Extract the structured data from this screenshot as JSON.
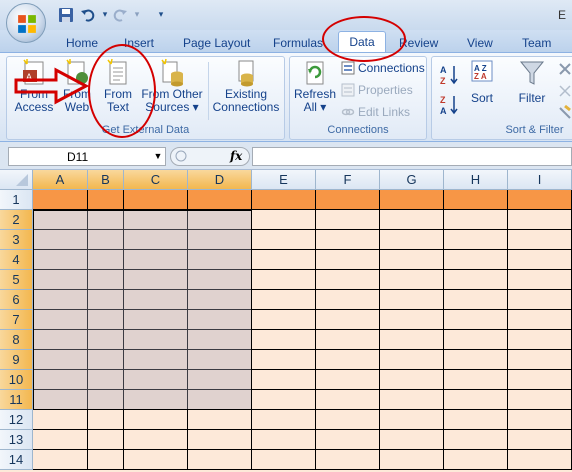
{
  "title_bar": {
    "title_fragment": "E"
  },
  "quick_access": {
    "undo_arrow": "▾",
    "redo_arrow": "▾",
    "customize_arrow": "▾"
  },
  "tabs": [
    "Home",
    "Insert",
    "Page Layout",
    "Formulas",
    "Data",
    "Review",
    "View",
    "Team"
  ],
  "active_tab": "Data",
  "ribbon": {
    "get_external_data": {
      "label": "Get External Data",
      "buttons": [
        {
          "line1": "From",
          "line2": "Access",
          "icon": "access-db-icon"
        },
        {
          "line1": "From",
          "line2": "Web",
          "icon": "web-globe-icon"
        },
        {
          "line1": "From",
          "line2": "Text",
          "icon": "text-file-icon"
        },
        {
          "line1": "From Other",
          "line2": "Sources ▾",
          "icon": "other-sources-icon"
        },
        {
          "line1": "Existing",
          "line2": "Connections",
          "icon": "existing-connections-icon"
        }
      ]
    },
    "connections": {
      "label": "Connections",
      "refresh_line1": "Refresh",
      "refresh_line2": "All ▾",
      "items": [
        {
          "label": "Connections",
          "enabled": true
        },
        {
          "label": "Properties",
          "enabled": false
        },
        {
          "label": "Edit Links",
          "enabled": false
        }
      ]
    },
    "sort_filter": {
      "label": "Sort & Filter",
      "sort_label": "Sort",
      "filter_label": "Filter",
      "sort_az_icon": "sort-ascending-icon",
      "sort_za_icon": "sort-descending-icon"
    }
  },
  "formula_bar": {
    "name_box": "D11",
    "fx": "fx",
    "formula": ""
  },
  "columns": [
    "A",
    "B",
    "C",
    "D",
    "E",
    "F",
    "G",
    "H",
    "I"
  ],
  "rows": [
    "1",
    "2",
    "3",
    "4",
    "5",
    "6",
    "7",
    "8",
    "9",
    "10",
    "11",
    "12",
    "13",
    "14"
  ],
  "selected_range": "A2:D11",
  "colors": {
    "header_row_fill": "#f79646",
    "body_fill": "#fde9d9",
    "selection_tint": "#e6dfe6",
    "annotation": "#d40000"
  }
}
